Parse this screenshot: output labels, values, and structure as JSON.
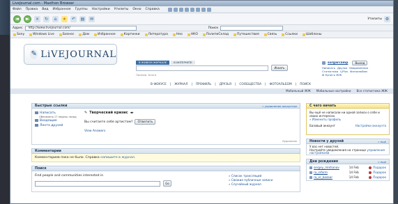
{
  "window": {
    "title": "LiveJournal.com - Maxthon Browser"
  },
  "menu": [
    "Файл",
    "Правка",
    "Вид",
    "Избранное",
    "Группы",
    "Настройки",
    "Утилиты",
    "Окно",
    "Справка"
  ],
  "address": {
    "label": "Адрес",
    "url": "http://www.livejournal.com/",
    "search_label": "Поиск"
  },
  "toolbar": {
    "right_label": "Утилиты"
  },
  "favorites": [
    "Sony",
    "Windows Live",
    "Бизнес",
    "Дом",
    "Избранное",
    "Картинки",
    "Литература",
    "Нео",
    "НКО",
    "ПолитиСклад",
    "Путешествия",
    "Связь",
    "Ссылки",
    "Шаблоны"
  ],
  "lj": {
    "logo_text": "LiVEJOURNAL",
    "search_tabs": [
      "В ЖИВОМ ЖУРНАЛЕ",
      "В ИНТЕРНЕТЕ"
    ],
    "search_button": "Искать",
    "search_example": "Пример: блоги",
    "username": "sorgarcamp",
    "logout": "Выход",
    "user_links": [
      "Написать",
      "Друзья",
      "Уведомления",
      "Статистика",
      "LjPlus",
      "Фотоальбом",
      "Ф Купить ЖЖ"
    ],
    "nav": [
      "В ФОКУСЕ",
      "ЖУРНАЛ",
      "ПРОФИЛЬ",
      "ДРУЗЬЯ",
      "СООБЩЕСТВА",
      "ФОТОАЛЬБОМ",
      "ПОИСК"
    ],
    "subbar": [
      "Мобильный ЖЖ",
      "Мобильные настройки",
      "Все статистика ЖЖ"
    ]
  },
  "quick_links": {
    "title": "Быстрые ссылки",
    "manage": "» управление аккаунтом",
    "items": [
      {
        "label": "Написать",
        "sub": "Обновлено 17 недель назад"
      },
      {
        "label": "Входящие",
        "sub": ""
      },
      {
        "label": "Лента друзей",
        "sub": ""
      }
    ],
    "crisis_title": "Творческий кризис",
    "question": "Вы считаете себя артистом?",
    "answer_button": "Ответить",
    "view_answers": "View Answers",
    "ad_label": "Будильник"
  },
  "comments": {
    "title": "Комментарии",
    "text": "Комментариев пока не было. Справка",
    "link": "напишите в журнал."
  },
  "find": {
    "title": "Поиск",
    "label": "Find people and communities interested in",
    "go": "Go",
    "links": [
      "» Список трансляций",
      "» Свежие публичные записи",
      "» Случайный журнал"
    ]
  },
  "start": {
    "title": "С чего начать",
    "text": "Вы ещё не написали ни одной записи о себе и своих интересах.",
    "link": "» Изменить профиль",
    "account": "Базовый аккаунт",
    "settings": "Настройки аккаунта"
  },
  "friends_news": {
    "title": "Новости у друзей",
    "more": "» ещё",
    "text": "У вас нет новостей.",
    "text2": "Настройте уведомления на странице",
    "link": "управления настройками"
  },
  "birthdays": {
    "title": "Дни рождения",
    "more": "» ещё",
    "rows": [
      {
        "user": "sergey_mikhanov",
        "date": "14 Feb",
        "gift": "Подарок"
      },
      {
        "user": "ra_inform",
        "date": "14 Feb",
        "gift": "Подарок"
      },
      {
        "user": "ra_or_bazaar",
        "date": "14 Feb",
        "gift": "Подарок"
      }
    ]
  }
}
